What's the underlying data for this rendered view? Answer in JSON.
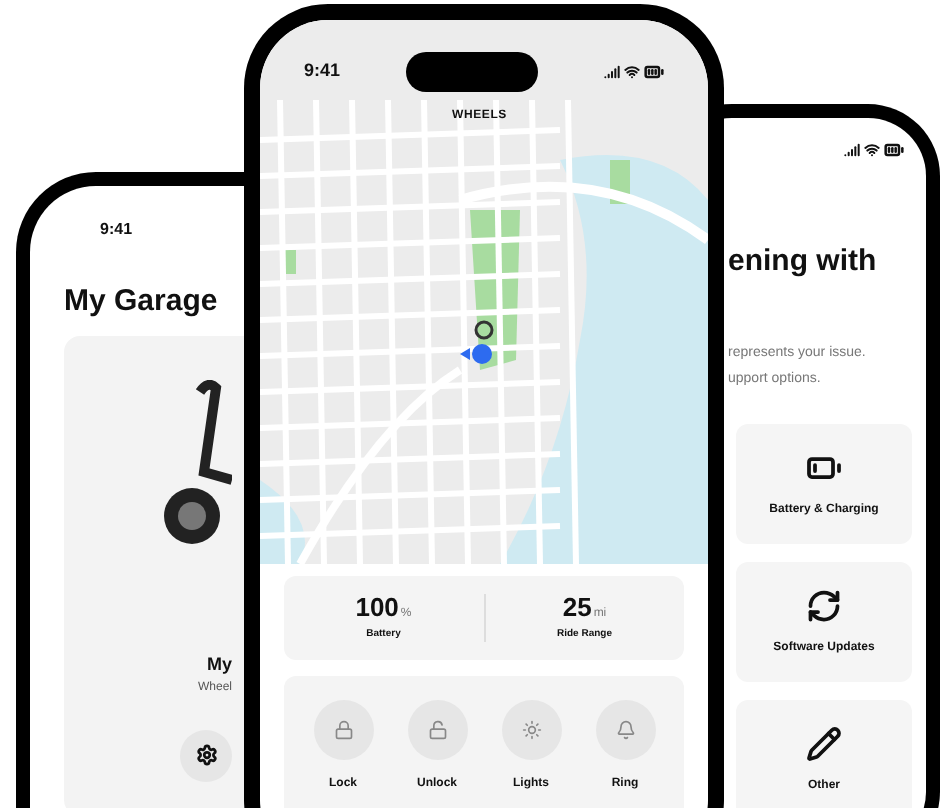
{
  "garage_phone": {
    "time": "9:41",
    "title": "My Garage",
    "vehicle_name": "My",
    "vehicle_model": "Wheel"
  },
  "map_phone": {
    "time": "9:41",
    "title": "WHEELS",
    "stats": [
      {
        "value": "100",
        "unit": "%",
        "label": "Battery"
      },
      {
        "value": "25",
        "unit": "mi",
        "label": "Ride Range"
      }
    ],
    "controls": [
      {
        "kind": "lock",
        "label": "Lock"
      },
      {
        "kind": "unlock",
        "label": "Unlock"
      },
      {
        "kind": "lights",
        "label": "Lights"
      },
      {
        "kind": "ring",
        "label": "Ring"
      }
    ]
  },
  "support_phone": {
    "title": "ening with",
    "description_lines": [
      "represents your issue.",
      "upport options."
    ],
    "options": [
      {
        "kind": "battery",
        "label": "Battery & Charging"
      },
      {
        "kind": "update",
        "label": "Software Updates"
      },
      {
        "kind": "edit",
        "label": "Other"
      }
    ]
  }
}
